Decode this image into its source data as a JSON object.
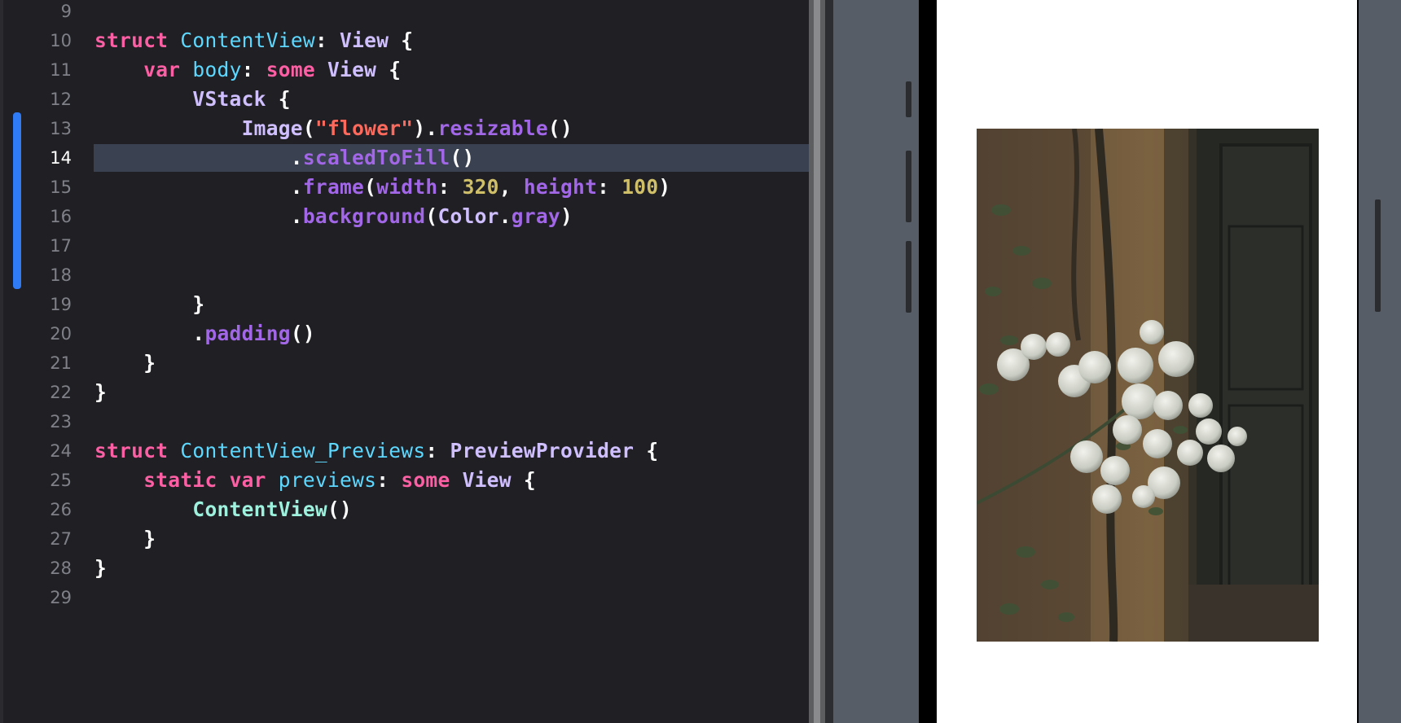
{
  "editor": {
    "current_line": "14",
    "lines": [
      {
        "n": "9",
        "tokens": []
      },
      {
        "n": "10",
        "tokens": [
          [
            "kw",
            "struct"
          ],
          [
            "plain",
            " "
          ],
          [
            "typed",
            "ContentView"
          ],
          [
            "plain",
            ": "
          ],
          [
            "type",
            "View"
          ],
          [
            "plain",
            " {"
          ]
        ]
      },
      {
        "n": "11",
        "tokens": [
          [
            "plain",
            "    "
          ],
          [
            "kw",
            "var"
          ],
          [
            "plain",
            " "
          ],
          [
            "typed",
            "body"
          ],
          [
            "plain",
            ": "
          ],
          [
            "kw",
            "some"
          ],
          [
            "plain",
            " "
          ],
          [
            "type",
            "View"
          ],
          [
            "plain",
            " {"
          ]
        ]
      },
      {
        "n": "12",
        "tokens": [
          [
            "plain",
            "        "
          ],
          [
            "type",
            "VStack"
          ],
          [
            "plain",
            " {"
          ]
        ]
      },
      {
        "n": "13",
        "tokens": [
          [
            "plain",
            "            "
          ],
          [
            "type",
            "Image"
          ],
          [
            "plain",
            "("
          ],
          [
            "str",
            "\"flower\""
          ],
          [
            "plain",
            ")."
          ],
          [
            "method",
            "resizable"
          ],
          [
            "plain",
            "()"
          ]
        ]
      },
      {
        "n": "14",
        "tokens": [
          [
            "plain",
            "                ."
          ],
          [
            "method",
            "scaledToFill"
          ],
          [
            "plain",
            "()"
          ]
        ]
      },
      {
        "n": "15",
        "tokens": [
          [
            "plain",
            "                ."
          ],
          [
            "method",
            "frame"
          ],
          [
            "plain",
            "("
          ],
          [
            "method",
            "width"
          ],
          [
            "plain",
            ": "
          ],
          [
            "num",
            "320"
          ],
          [
            "plain",
            ", "
          ],
          [
            "method",
            "height"
          ],
          [
            "plain",
            ": "
          ],
          [
            "num",
            "100"
          ],
          [
            "plain",
            ")"
          ]
        ]
      },
      {
        "n": "16",
        "tokens": [
          [
            "plain",
            "                ."
          ],
          [
            "method",
            "background"
          ],
          [
            "plain",
            "("
          ],
          [
            "type",
            "Color"
          ],
          [
            "plain",
            "."
          ],
          [
            "method",
            "gray"
          ],
          [
            "plain",
            ")"
          ]
        ]
      },
      {
        "n": "17",
        "tokens": []
      },
      {
        "n": "18",
        "tokens": []
      },
      {
        "n": "19",
        "tokens": [
          [
            "plain",
            "        }"
          ]
        ]
      },
      {
        "n": "20",
        "tokens": [
          [
            "plain",
            "        ."
          ],
          [
            "method",
            "padding"
          ],
          [
            "plain",
            "()"
          ]
        ]
      },
      {
        "n": "21",
        "tokens": [
          [
            "plain",
            "    }"
          ]
        ]
      },
      {
        "n": "22",
        "tokens": [
          [
            "plain",
            "}"
          ]
        ]
      },
      {
        "n": "23",
        "tokens": []
      },
      {
        "n": "24",
        "tokens": [
          [
            "kw",
            "struct"
          ],
          [
            "plain",
            " "
          ],
          [
            "typed",
            "ContentView_Previews"
          ],
          [
            "plain",
            ": "
          ],
          [
            "type",
            "PreviewProvider"
          ],
          [
            "plain",
            " {"
          ]
        ]
      },
      {
        "n": "25",
        "tokens": [
          [
            "plain",
            "    "
          ],
          [
            "kw",
            "static"
          ],
          [
            "plain",
            " "
          ],
          [
            "kw",
            "var"
          ],
          [
            "plain",
            " "
          ],
          [
            "typed",
            "previews"
          ],
          [
            "plain",
            ": "
          ],
          [
            "kw",
            "some"
          ],
          [
            "plain",
            " "
          ],
          [
            "type",
            "View"
          ],
          [
            "plain",
            " {"
          ]
        ]
      },
      {
        "n": "26",
        "tokens": [
          [
            "plain",
            "        "
          ],
          [
            "cls",
            "ContentView"
          ],
          [
            "plain",
            "()"
          ]
        ]
      },
      {
        "n": "27",
        "tokens": [
          [
            "plain",
            "    }"
          ]
        ]
      },
      {
        "n": "28",
        "tokens": [
          [
            "plain",
            "}"
          ]
        ]
      },
      {
        "n": "29",
        "tokens": []
      }
    ]
  },
  "colors": {
    "keyword": "#fc5fa3",
    "type": "#d0bfff",
    "declared": "#5dd8ff",
    "method": "#a167e6",
    "string": "#fc6a5d",
    "number": "#d0bf69",
    "change_bar": "#2f7bf6",
    "current_line": "#3a4150"
  },
  "preview": {
    "image_name": "flower-photo",
    "description_icon": "photo-icon"
  }
}
